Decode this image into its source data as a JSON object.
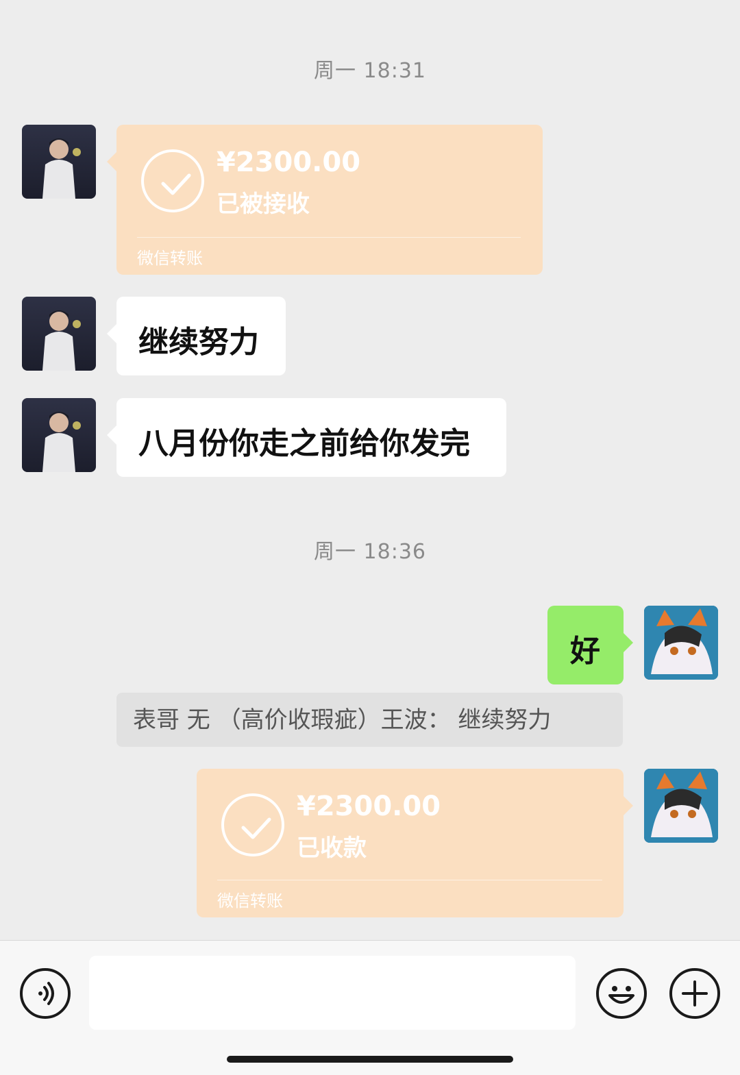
{
  "timestamps": [
    "周一 18:31",
    "周一 18:36"
  ],
  "messages": {
    "transfer_received": {
      "amount": "¥2300.00",
      "status": "已被接收",
      "label": "微信转账"
    },
    "text_1": "继续努力",
    "text_2": "八月份你走之前给你发完",
    "my_text": "好",
    "quote": "表哥  无  （高价收瑕疵）王波：  继续努力",
    "transfer_sent": {
      "amount": "¥2300.00",
      "status": "已收款",
      "label": "微信转账"
    }
  },
  "input": {
    "value": "",
    "placeholder": ""
  },
  "icons": {
    "voice": "voice-icon",
    "emoji": "emoji-icon",
    "more": "plus-icon"
  },
  "colors": {
    "background": "#ededed",
    "my_bubble": "#95ec69",
    "their_bubble": "#ffffff",
    "transfer_bubble": "#fbdfc1"
  }
}
